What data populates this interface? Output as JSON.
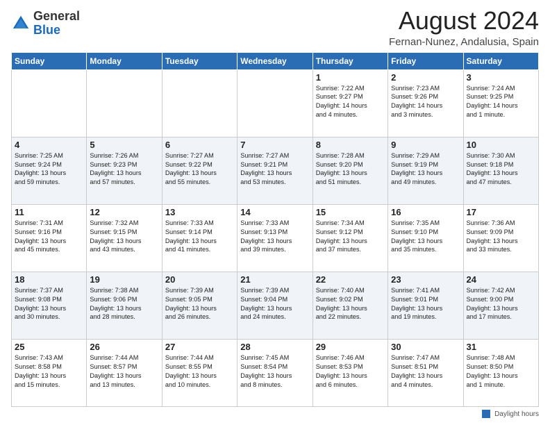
{
  "logo": {
    "general": "General",
    "blue": "Blue"
  },
  "title": "August 2024",
  "location": "Fernan-Nunez, Andalusia, Spain",
  "weekdays": [
    "Sunday",
    "Monday",
    "Tuesday",
    "Wednesday",
    "Thursday",
    "Friday",
    "Saturday"
  ],
  "weeks": [
    [
      {
        "day": "",
        "info": ""
      },
      {
        "day": "",
        "info": ""
      },
      {
        "day": "",
        "info": ""
      },
      {
        "day": "",
        "info": ""
      },
      {
        "day": "1",
        "info": "Sunrise: 7:22 AM\nSunset: 9:27 PM\nDaylight: 14 hours\nand 4 minutes."
      },
      {
        "day": "2",
        "info": "Sunrise: 7:23 AM\nSunset: 9:26 PM\nDaylight: 14 hours\nand 3 minutes."
      },
      {
        "day": "3",
        "info": "Sunrise: 7:24 AM\nSunset: 9:25 PM\nDaylight: 14 hours\nand 1 minute."
      }
    ],
    [
      {
        "day": "4",
        "info": "Sunrise: 7:25 AM\nSunset: 9:24 PM\nDaylight: 13 hours\nand 59 minutes."
      },
      {
        "day": "5",
        "info": "Sunrise: 7:26 AM\nSunset: 9:23 PM\nDaylight: 13 hours\nand 57 minutes."
      },
      {
        "day": "6",
        "info": "Sunrise: 7:27 AM\nSunset: 9:22 PM\nDaylight: 13 hours\nand 55 minutes."
      },
      {
        "day": "7",
        "info": "Sunrise: 7:27 AM\nSunset: 9:21 PM\nDaylight: 13 hours\nand 53 minutes."
      },
      {
        "day": "8",
        "info": "Sunrise: 7:28 AM\nSunset: 9:20 PM\nDaylight: 13 hours\nand 51 minutes."
      },
      {
        "day": "9",
        "info": "Sunrise: 7:29 AM\nSunset: 9:19 PM\nDaylight: 13 hours\nand 49 minutes."
      },
      {
        "day": "10",
        "info": "Sunrise: 7:30 AM\nSunset: 9:18 PM\nDaylight: 13 hours\nand 47 minutes."
      }
    ],
    [
      {
        "day": "11",
        "info": "Sunrise: 7:31 AM\nSunset: 9:16 PM\nDaylight: 13 hours\nand 45 minutes."
      },
      {
        "day": "12",
        "info": "Sunrise: 7:32 AM\nSunset: 9:15 PM\nDaylight: 13 hours\nand 43 minutes."
      },
      {
        "day": "13",
        "info": "Sunrise: 7:33 AM\nSunset: 9:14 PM\nDaylight: 13 hours\nand 41 minutes."
      },
      {
        "day": "14",
        "info": "Sunrise: 7:33 AM\nSunset: 9:13 PM\nDaylight: 13 hours\nand 39 minutes."
      },
      {
        "day": "15",
        "info": "Sunrise: 7:34 AM\nSunset: 9:12 PM\nDaylight: 13 hours\nand 37 minutes."
      },
      {
        "day": "16",
        "info": "Sunrise: 7:35 AM\nSunset: 9:10 PM\nDaylight: 13 hours\nand 35 minutes."
      },
      {
        "day": "17",
        "info": "Sunrise: 7:36 AM\nSunset: 9:09 PM\nDaylight: 13 hours\nand 33 minutes."
      }
    ],
    [
      {
        "day": "18",
        "info": "Sunrise: 7:37 AM\nSunset: 9:08 PM\nDaylight: 13 hours\nand 30 minutes."
      },
      {
        "day": "19",
        "info": "Sunrise: 7:38 AM\nSunset: 9:06 PM\nDaylight: 13 hours\nand 28 minutes."
      },
      {
        "day": "20",
        "info": "Sunrise: 7:39 AM\nSunset: 9:05 PM\nDaylight: 13 hours\nand 26 minutes."
      },
      {
        "day": "21",
        "info": "Sunrise: 7:39 AM\nSunset: 9:04 PM\nDaylight: 13 hours\nand 24 minutes."
      },
      {
        "day": "22",
        "info": "Sunrise: 7:40 AM\nSunset: 9:02 PM\nDaylight: 13 hours\nand 22 minutes."
      },
      {
        "day": "23",
        "info": "Sunrise: 7:41 AM\nSunset: 9:01 PM\nDaylight: 13 hours\nand 19 minutes."
      },
      {
        "day": "24",
        "info": "Sunrise: 7:42 AM\nSunset: 9:00 PM\nDaylight: 13 hours\nand 17 minutes."
      }
    ],
    [
      {
        "day": "25",
        "info": "Sunrise: 7:43 AM\nSunset: 8:58 PM\nDaylight: 13 hours\nand 15 minutes."
      },
      {
        "day": "26",
        "info": "Sunrise: 7:44 AM\nSunset: 8:57 PM\nDaylight: 13 hours\nand 13 minutes."
      },
      {
        "day": "27",
        "info": "Sunrise: 7:44 AM\nSunset: 8:55 PM\nDaylight: 13 hours\nand 10 minutes."
      },
      {
        "day": "28",
        "info": "Sunrise: 7:45 AM\nSunset: 8:54 PM\nDaylight: 13 hours\nand 8 minutes."
      },
      {
        "day": "29",
        "info": "Sunrise: 7:46 AM\nSunset: 8:53 PM\nDaylight: 13 hours\nand 6 minutes."
      },
      {
        "day": "30",
        "info": "Sunrise: 7:47 AM\nSunset: 8:51 PM\nDaylight: 13 hours\nand 4 minutes."
      },
      {
        "day": "31",
        "info": "Sunrise: 7:48 AM\nSunset: 8:50 PM\nDaylight: 13 hours\nand 1 minute."
      }
    ]
  ],
  "legend": {
    "label": "Daylight hours"
  }
}
